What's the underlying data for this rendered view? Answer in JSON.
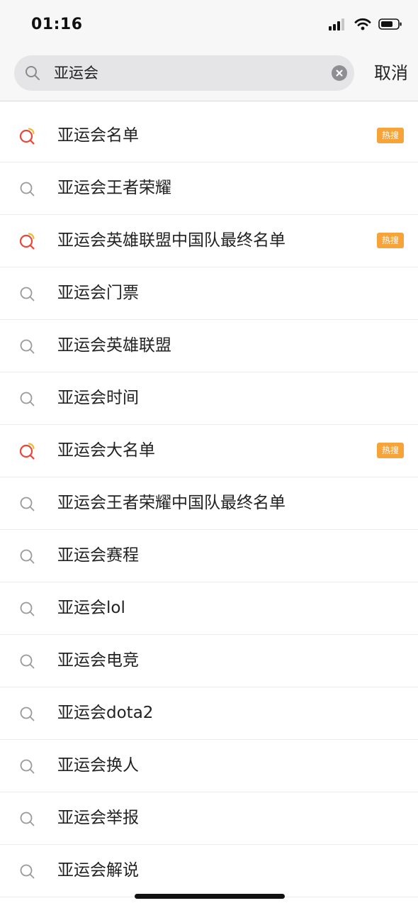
{
  "status_bar": {
    "time": "01:16"
  },
  "search": {
    "query": "亚运会",
    "cancel_label": "取消"
  },
  "colors": {
    "hot_badge": "#f6a43a",
    "hot_icon_red": "#e8473b",
    "hot_icon_yellow": "#f5b82e",
    "search_icon_gray": "#9a9a9a"
  },
  "suggestions": [
    {
      "label": "亚运会名单",
      "hot": true,
      "hot_label": "热搜",
      "icon": "hot-search-icon"
    },
    {
      "label": "亚运会王者荣耀",
      "hot": false,
      "icon": "search-icon"
    },
    {
      "label": "亚运会英雄联盟中国队最终名单",
      "hot": true,
      "hot_label": "热搜",
      "icon": "hot-search-icon"
    },
    {
      "label": "亚运会门票",
      "hot": false,
      "icon": "search-icon"
    },
    {
      "label": "亚运会英雄联盟",
      "hot": false,
      "icon": "search-icon"
    },
    {
      "label": "亚运会时间",
      "hot": false,
      "icon": "search-icon"
    },
    {
      "label": "亚运会大名单",
      "hot": true,
      "hot_label": "热搜",
      "icon": "hot-search-icon"
    },
    {
      "label": "亚运会王者荣耀中国队最终名单",
      "hot": false,
      "icon": "search-icon"
    },
    {
      "label": "亚运会赛程",
      "hot": false,
      "icon": "search-icon"
    },
    {
      "label": "亚运会lol",
      "hot": false,
      "icon": "search-icon"
    },
    {
      "label": "亚运会电竞",
      "hot": false,
      "icon": "search-icon"
    },
    {
      "label": "亚运会dota2",
      "hot": false,
      "icon": "search-icon"
    },
    {
      "label": "亚运会换人",
      "hot": false,
      "icon": "search-icon"
    },
    {
      "label": "亚运会举报",
      "hot": false,
      "icon": "search-icon"
    },
    {
      "label": "亚运会解说",
      "hot": false,
      "icon": "search-icon"
    }
  ]
}
